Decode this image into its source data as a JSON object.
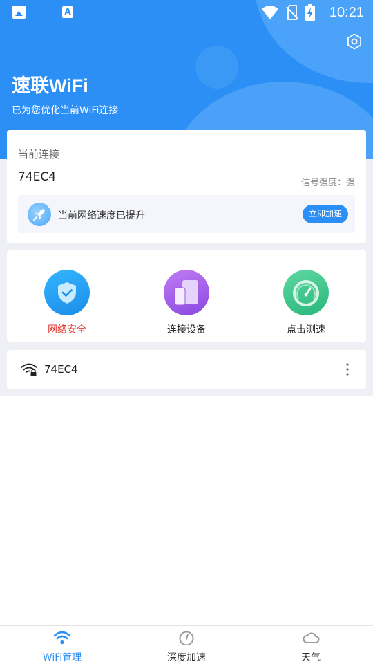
{
  "status_bar": {
    "time": "10:21",
    "left_icons": [
      "image-icon",
      "a-letter-icon"
    ],
    "right_icons": [
      "wifi-signal-icon",
      "no-sim-icon",
      "battery-charging-icon"
    ],
    "a_icon_text": "A"
  },
  "header": {
    "title": "速联WiFi",
    "subtitle": "已为您优化当前WiFi连接",
    "settings_icon": "settings-icon",
    "background_color": "#2b8ff5"
  },
  "current_connection": {
    "label": "当前连接",
    "ssid": "74EC4",
    "signal_text": "信号强度：强",
    "boost_message": "当前网络速度已提升",
    "boost_button": "立即加速"
  },
  "tools": [
    {
      "label": "网络安全",
      "icon": "shield-icon",
      "color": "#e53935"
    },
    {
      "label": "连接设备",
      "icon": "devices-icon",
      "color": "#333333"
    },
    {
      "label": "点击测速",
      "icon": "speedometer-icon",
      "color": "#333333"
    }
  ],
  "network_list": [
    {
      "ssid": "74EC4",
      "icon": "wifi-lock-icon",
      "menu_icon": "more-vertical-icon"
    }
  ],
  "bottom_nav": {
    "items": [
      {
        "label": "WiFi管理",
        "icon": "wifi-icon",
        "active": true
      },
      {
        "label": "深度加速",
        "icon": "gauge-icon",
        "active": false
      },
      {
        "label": "天气",
        "icon": "cloud-icon",
        "active": false
      }
    ],
    "accent": "#2b8ff5"
  }
}
